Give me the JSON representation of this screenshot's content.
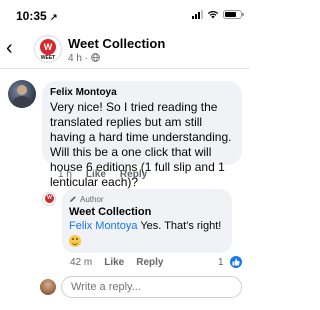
{
  "status_bar": {
    "time": "10:35",
    "location_arrow": "↗"
  },
  "header": {
    "back_glyph": "‹",
    "page_logo_text": "W",
    "page_logo_word": "WEET",
    "title": "Weet Collection",
    "timestamp": "4 h",
    "audience_icon": "globe-icon"
  },
  "comment": {
    "author": "Felix Montoya",
    "text": "Very nice! So I tried reading the translated replies but am still having a hard time understanding. Will this be a one click that will house 6 editions (1 full slip and 1 lenticular each)?",
    "time": "1 h",
    "like_label": "Like",
    "reply_label": "Reply"
  },
  "reply": {
    "author_badge": "Author",
    "author": "Weet Collection",
    "mention": "Felix Montoya",
    "text": "Yes. That's right!",
    "time": "42 m",
    "like_label": "Like",
    "reply_label": "Reply",
    "reaction_count": "1"
  },
  "composer": {
    "placeholder": "Write a reply..."
  },
  "colors": {
    "accent": "#1877f2",
    "bubble": "#f0f2f5",
    "brand_red": "#d7262e"
  }
}
